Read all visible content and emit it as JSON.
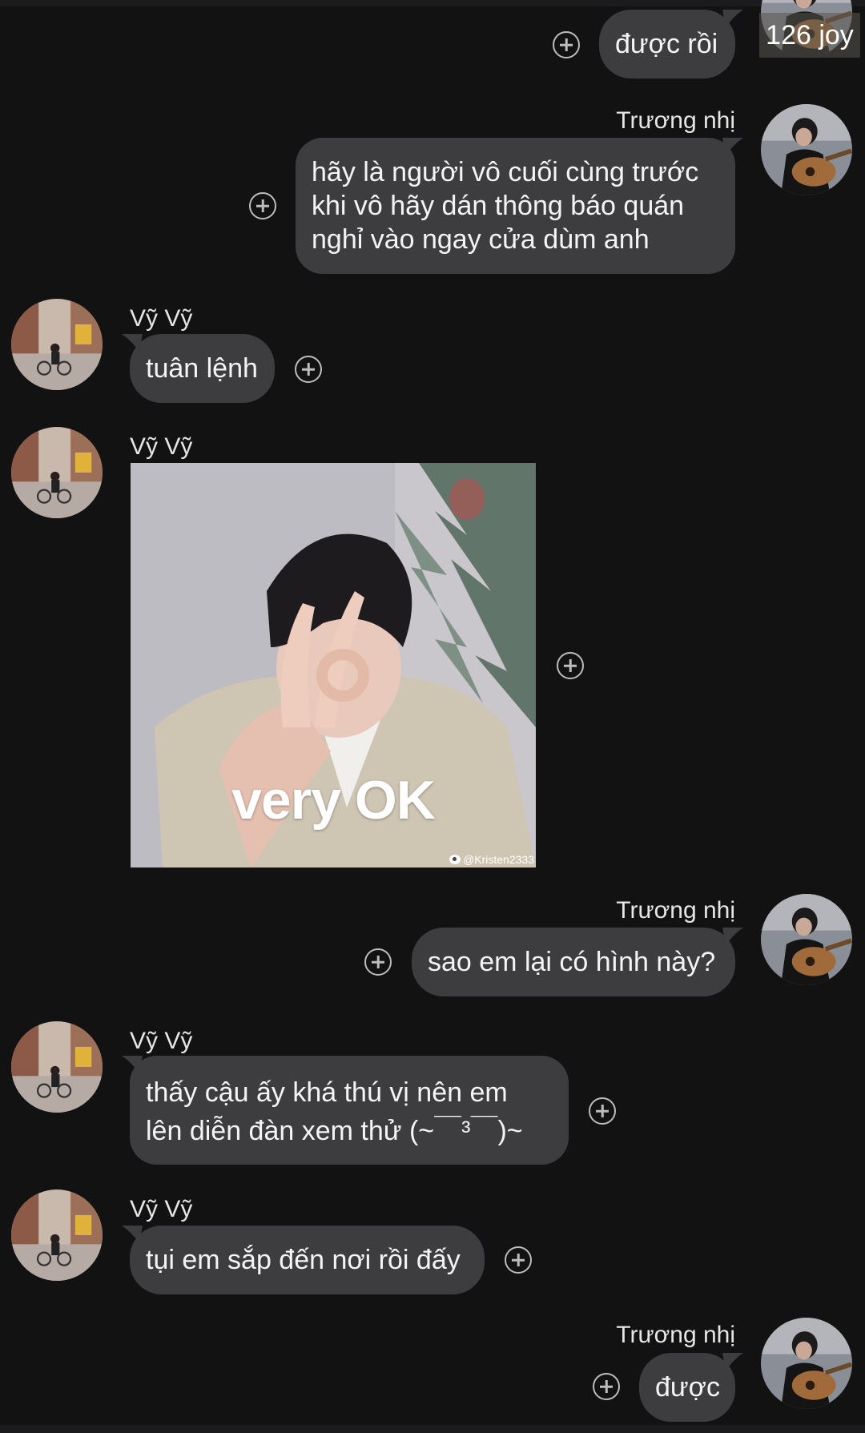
{
  "badge": {
    "joy_text": "126 joy"
  },
  "messages": [
    {
      "id": "m1",
      "side": "right",
      "sender": "",
      "text": "được rồi"
    },
    {
      "id": "m2",
      "side": "right",
      "sender": "Trương nhị",
      "lines": [
        "hãy là người vô cuối cùng trước",
        "khi vô hãy dán thông báo quán",
        "nghỉ vào ngay cửa dùm anh"
      ]
    },
    {
      "id": "m3",
      "side": "left",
      "sender": "Vỹ Vỹ",
      "text": "tuân lệnh"
    },
    {
      "id": "m4",
      "side": "left",
      "sender": "Vỹ Vỹ",
      "sticker": {
        "caption": "very OK",
        "watermark": "@Kristen2333"
      }
    },
    {
      "id": "m5",
      "side": "right",
      "sender": "Trương nhị",
      "text": "sao em lại có hình này?"
    },
    {
      "id": "m6",
      "side": "left",
      "sender": "Vỹ Vỹ",
      "lines": [
        "thấy cậu ấy khá thú vị nên em",
        "lên diễn đàn xem thử (~￣³￣)~"
      ]
    },
    {
      "id": "m7",
      "side": "left",
      "sender": "Vỹ Vỹ",
      "text": "tụi em sắp đến nơi rồi đấy"
    },
    {
      "id": "m8",
      "side": "right",
      "sender": "Trương nhị",
      "text": "được"
    }
  ],
  "colors": {
    "background": "#121213",
    "bubble": "#3d3d40",
    "text": "#f4f4f4",
    "name": "#e6e6e6",
    "plus_icon": "#bdbdbd"
  }
}
